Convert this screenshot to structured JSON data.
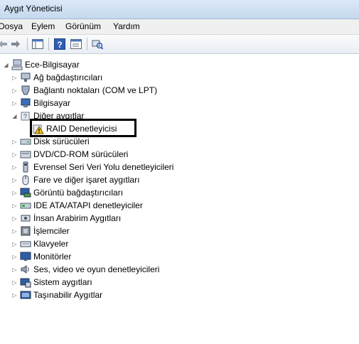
{
  "window": {
    "title": "Aygıt Yöneticisi"
  },
  "menu": [
    "Dosya",
    "Eylem",
    "Görünüm",
    "Yardım"
  ],
  "toolbar": {
    "buttons": [
      {
        "name": "back-button",
        "icon": "arrow-left-icon"
      },
      {
        "name": "forward-button",
        "icon": "arrow-right-icon"
      },
      {
        "name": "show-hide-console-tree-button",
        "icon": "console-tree-icon"
      },
      {
        "name": "help-button",
        "icon": "help-icon"
      },
      {
        "name": "properties-button",
        "icon": "properties-icon"
      },
      {
        "name": "scan-hardware-button",
        "icon": "scan-hardware-icon"
      }
    ]
  },
  "tree": {
    "root": "Ece-Bilgisayar",
    "items": [
      {
        "label": "Ağ bağdaştırıcıları",
        "icon": "network-adapter-icon"
      },
      {
        "label": "Bağlantı noktaları (COM ve LPT)",
        "icon": "port-icon"
      },
      {
        "label": "Bilgisayar",
        "icon": "computer-icon"
      },
      {
        "label": "Diğer aygıtlar",
        "icon": "unknown-device-icon",
        "expanded": true,
        "children": [
          {
            "label": "RAID Denetleyicisi",
            "icon": "warning-device-icon"
          }
        ]
      },
      {
        "label": "Disk sürücüleri",
        "icon": "disk-drive-icon"
      },
      {
        "label": "DVD/CD-ROM sürücüleri",
        "icon": "dvd-drive-icon"
      },
      {
        "label": "Evrensel Seri Veri Yolu denetleyicileri",
        "icon": "usb-icon"
      },
      {
        "label": "Fare ve diğer işaret aygıtları",
        "icon": "mouse-icon"
      },
      {
        "label": "Görüntü bağdaştırıcıları",
        "icon": "display-adapter-icon"
      },
      {
        "label": "IDE ATA/ATAPI denetleyiciler",
        "icon": "ide-controller-icon"
      },
      {
        "label": "İnsan Arabirim Aygıtları",
        "icon": "hid-icon"
      },
      {
        "label": "İşlemciler",
        "icon": "processor-icon"
      },
      {
        "label": "Klavyeler",
        "icon": "keyboard-icon"
      },
      {
        "label": "Monitörler",
        "icon": "monitor-icon"
      },
      {
        "label": "Ses, video ve oyun denetleyicileri",
        "icon": "sound-icon"
      },
      {
        "label": "Sistem aygıtları",
        "icon": "system-device-icon"
      },
      {
        "label": "Taşınabilir Aygıtlar",
        "icon": "portable-device-icon"
      }
    ]
  },
  "colors": {
    "highlight_border": "#000000",
    "title_bar": "#c4d8ef"
  }
}
